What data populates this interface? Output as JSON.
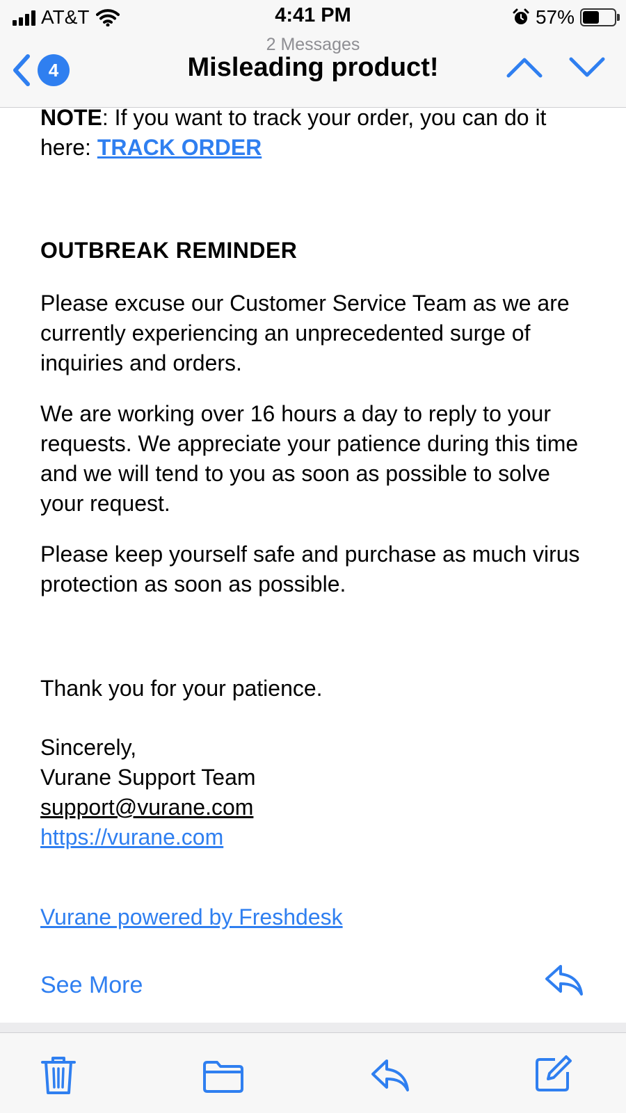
{
  "status_bar": {
    "carrier": "AT&T",
    "time": "4:41 PM",
    "battery_percent": "57%",
    "battery_level": 0.57,
    "icons": [
      "signal-icon",
      "wifi-icon",
      "alarm-icon",
      "battery-icon"
    ]
  },
  "nav": {
    "unread_count": "4",
    "message_count": "2 Messages",
    "subject": "Misleading product!",
    "icons": [
      "back-chevron-icon",
      "previous-message-icon",
      "next-message-icon"
    ]
  },
  "body": {
    "note_label": "NOTE",
    "note_text": ": If you want to track your order, you can do it here: ",
    "track_order_link": "TRACK ORDER",
    "heading": "OUTBREAK REMINDER",
    "para1": "Please excuse our Customer Service Team as we are currently experiencing an unprecedented surge of inquiries and orders.",
    "para2": "We are working over 16 hours a day to reply to your requests. We appreciate your patience during this time and we will tend to you as soon as possible to solve your request.",
    "para3": "Please keep yourself safe and purchase as much virus protection as soon as possible.",
    "thanks": "Thank you for your patience.",
    "signoff": "Sincerely,",
    "team": "Vurane Support Team",
    "email": "support@vurane.com",
    "website": "https://vurane.com",
    "footer_link": "Vurane powered by Freshdesk"
  },
  "see_more": "See More",
  "toolbar": {
    "icons": [
      "trash-icon",
      "folder-icon",
      "reply-icon",
      "compose-icon"
    ]
  },
  "colors": {
    "accent": "#2f7ff0",
    "bar_bg": "#f7f7f7"
  }
}
